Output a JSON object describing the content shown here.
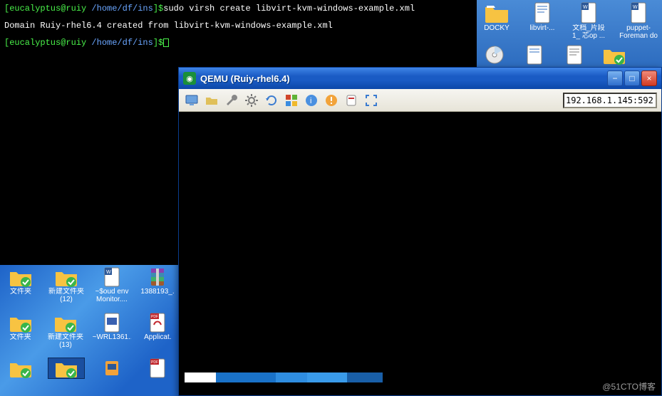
{
  "terminal": {
    "prompt_user": "[eucalyptus@ruiy ",
    "prompt_path": "/home/df/ins",
    "prompt_end": "]$",
    "command": "sudo virsh create libvirt-kvm-windows-example.xml",
    "output1": "Domain Ruiy-rhel6.4 created from libvirt-kvm-windows-example.xml"
  },
  "remote_desktop": {
    "row1": [
      {
        "label1": "DOCKY",
        "label2": ""
      },
      {
        "label1": "libvirt-...",
        "label2": ""
      },
      {
        "label1": "文档_片段",
        "label2": "1_ 芯op ..."
      },
      {
        "label1": "puppet-",
        "label2": "Foreman do"
      }
    ]
  },
  "desktop": {
    "row1": [
      {
        "l1": "文件夹",
        "l2": ""
      },
      {
        "l1": "新建文件夹",
        "l2": "(12)"
      },
      {
        "l1": "~$oud env",
        "l2": "Monitor...."
      },
      {
        "l1": "1388193_.",
        "l2": ""
      }
    ],
    "row2": [
      {
        "l1": "文件夹",
        "l2": ""
      },
      {
        "l1": "新建文件夹",
        "l2": "(13)"
      },
      {
        "l1": "~WRL1361...",
        "l2": ""
      },
      {
        "l1": "Applicat.",
        "l2": ""
      }
    ]
  },
  "qemu": {
    "title": "QEMU (Ruiy-rhel6.4)",
    "ip": "192.168.1.145:592"
  },
  "watermark": "@51CTO博客"
}
